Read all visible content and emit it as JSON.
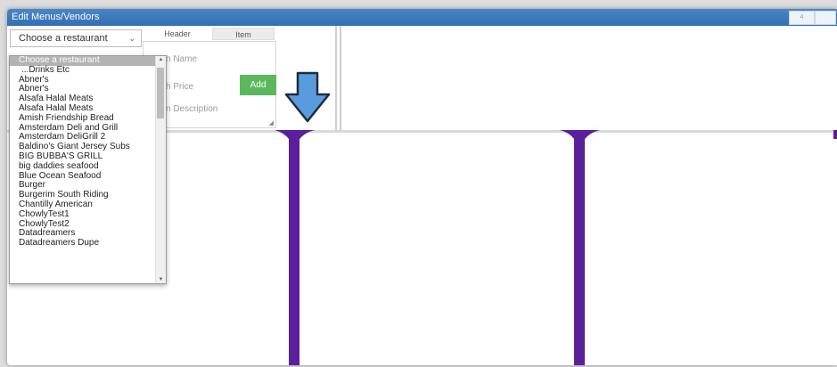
{
  "window": {
    "title": "Edit Menus/Vendors"
  },
  "titlebar_buttons": [
    "4",
    ""
  ],
  "restaurant_select": {
    "selected": "Choose a restaurant"
  },
  "tabs": [
    {
      "label": "Header"
    },
    {
      "label": "Item"
    }
  ],
  "editor": {
    "name_placeholder": "h Name",
    "price_placeholder": "h Price",
    "description_placeholder": "n Description",
    "add_label": "Add"
  },
  "dropdown": {
    "options": [
      "Choose a restaurant",
      "...Drinks Etc",
      "Abner's",
      "Abner's",
      "Alsafa Halal Meats",
      "Alsafa Halal Meats",
      "Amish Friendship Bread",
      "Amsterdam Deli and Grill",
      "Amsterdam DeliGrill 2",
      "Baldino's Giant Jersey Subs",
      "BIG BUBBA'S GRILL",
      "big daddies seafood",
      "Blue Ocean Seafood",
      "Burger",
      "Burgerim South Riding",
      "Chantilly American",
      "ChowlyTest1",
      "ChowlyTest2",
      "Datadreamers",
      "Datadreamers Dupe"
    ]
  },
  "colors": {
    "titlebar": "#3a7bbf",
    "add_button": "#5cb85c",
    "column_divider": "#5b1f9b",
    "arrow": "#5a9be0"
  }
}
